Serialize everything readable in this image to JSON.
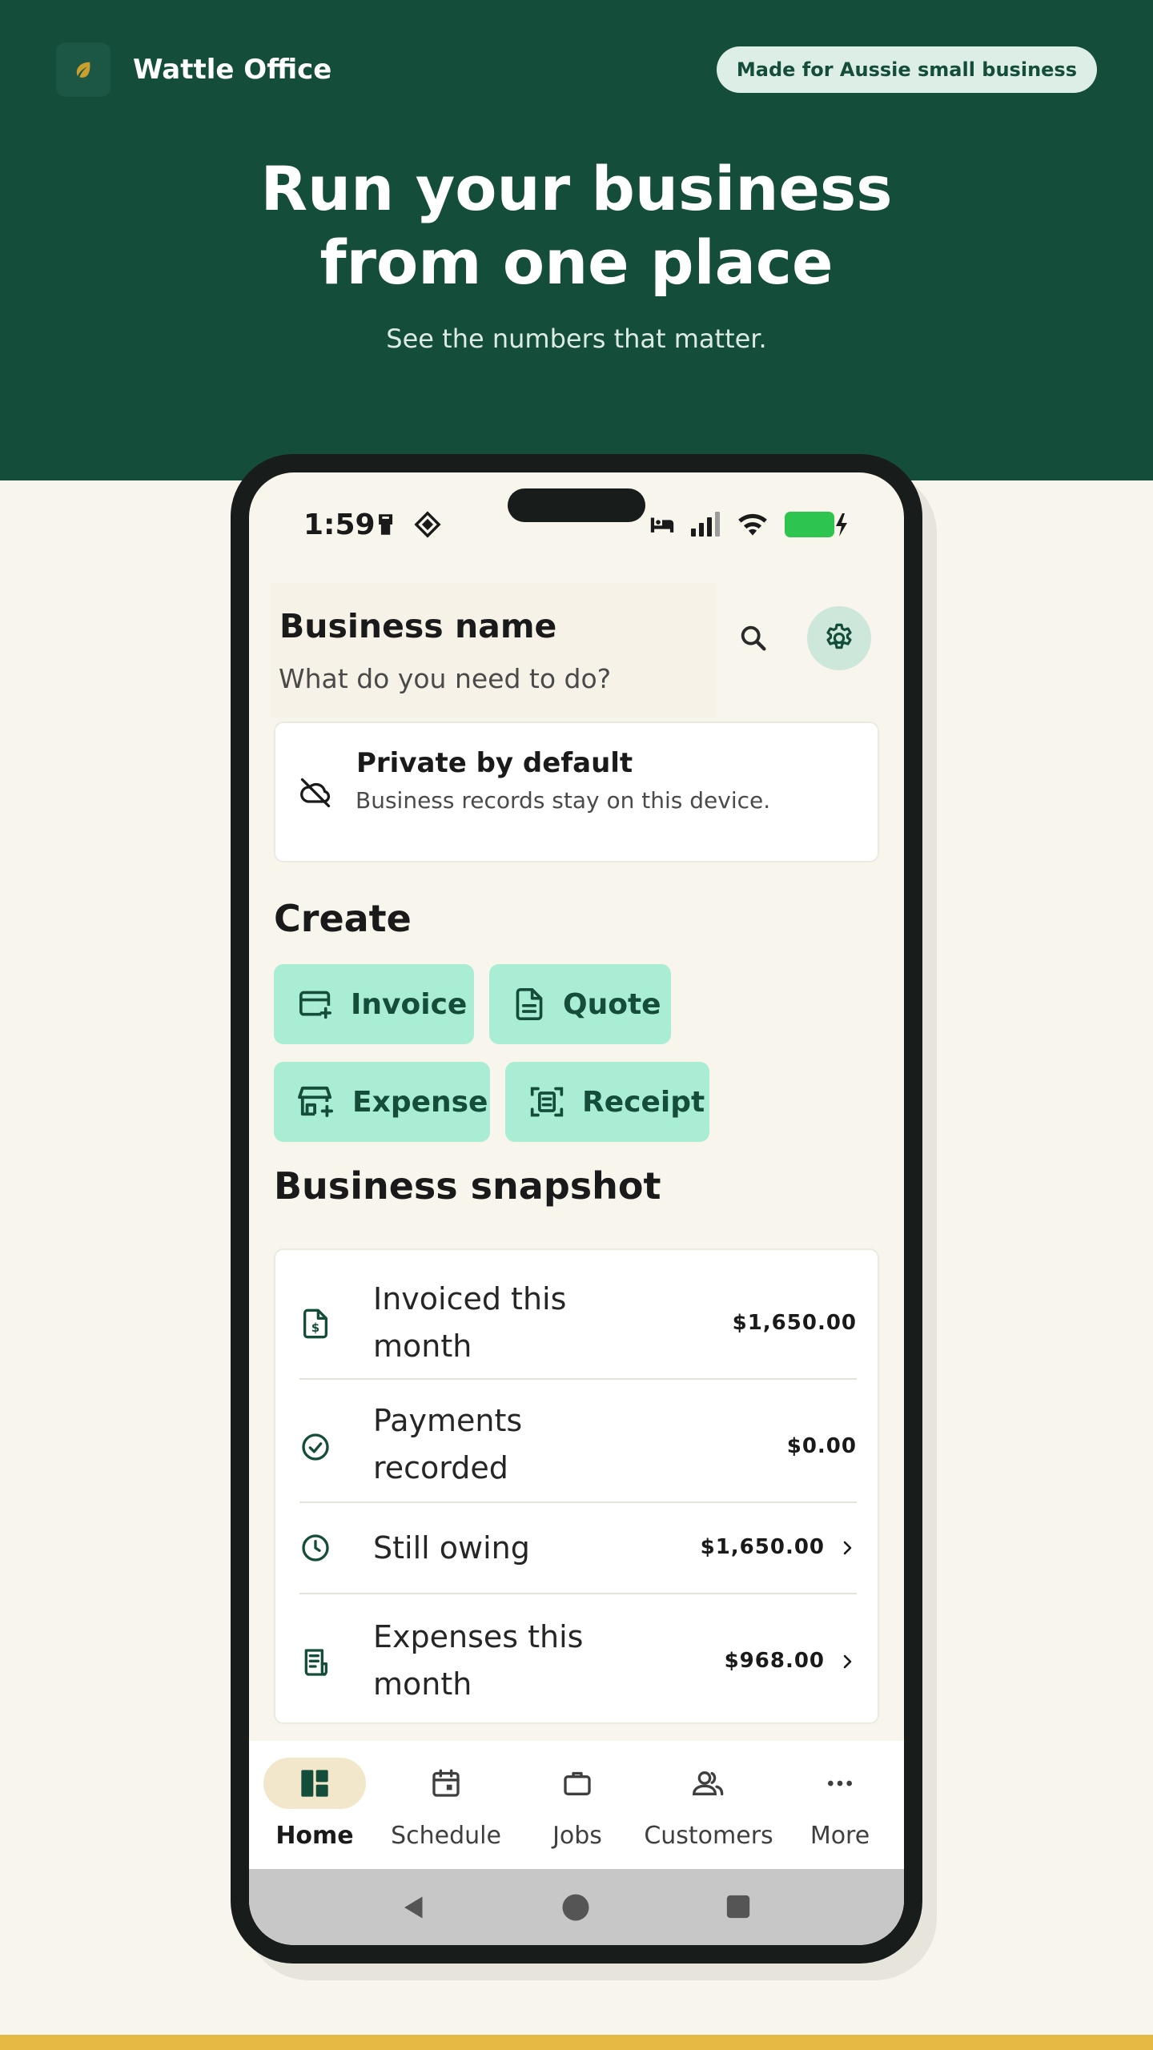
{
  "hero": {
    "brand_name": "Wattle Office",
    "badge": "Made for Aussie small business",
    "title_line1": "Run your business",
    "title_line2": "from one place",
    "subtitle": "See the numbers that matter."
  },
  "phone": {
    "status": {
      "time": "1:59"
    },
    "header": {
      "business_name": "Business name",
      "prompt": "What do you need to do?"
    },
    "privacy": {
      "title": "Private by default",
      "subtitle": "Business records stay on this device."
    },
    "create": {
      "title": "Create",
      "buttons": [
        {
          "label": "Invoice",
          "icon": "card-plus-icon"
        },
        {
          "label": "Quote",
          "icon": "document-icon"
        },
        {
          "label": "Expense",
          "icon": "store-plus-icon"
        },
        {
          "label": "Receipt",
          "icon": "receipt-scan-icon"
        }
      ]
    },
    "snapshot": {
      "title": "Business snapshot",
      "rows": [
        {
          "label_line1": "Invoiced this",
          "label_line2": "month",
          "value": "$1,650.00",
          "icon": "invoice-dollar-icon",
          "has_chevron": false
        },
        {
          "label_line1": "Payments",
          "label_line2": "recorded",
          "value": "$0.00",
          "icon": "check-circle-icon",
          "has_chevron": false
        },
        {
          "label_line1": "Still owing",
          "label_line2": "",
          "value": "$1,650.00",
          "icon": "clock-icon",
          "has_chevron": true
        },
        {
          "label_line1": "Expenses this",
          "label_line2": "month",
          "value": "$968.00",
          "icon": "receipt-icon",
          "has_chevron": true
        }
      ]
    },
    "nav": {
      "items": [
        {
          "label": "Home",
          "icon": "dashboard-icon",
          "active": true
        },
        {
          "label": "Schedule",
          "icon": "calendar-icon",
          "active": false
        },
        {
          "label": "Jobs",
          "icon": "briefcase-icon",
          "active": false
        },
        {
          "label": "Customers",
          "icon": "people-icon",
          "active": false
        },
        {
          "label": "More",
          "icon": "more-horizontal-icon",
          "active": false
        }
      ]
    }
  },
  "colors": {
    "hero_bg": "#154D3B",
    "page_bg": "#F8F5EC",
    "accent_mint": "#A9EDD4",
    "accent_dark_green": "#154D3B",
    "stripe_yellow": "#E4BA45",
    "battery_green": "#2DC44F"
  }
}
